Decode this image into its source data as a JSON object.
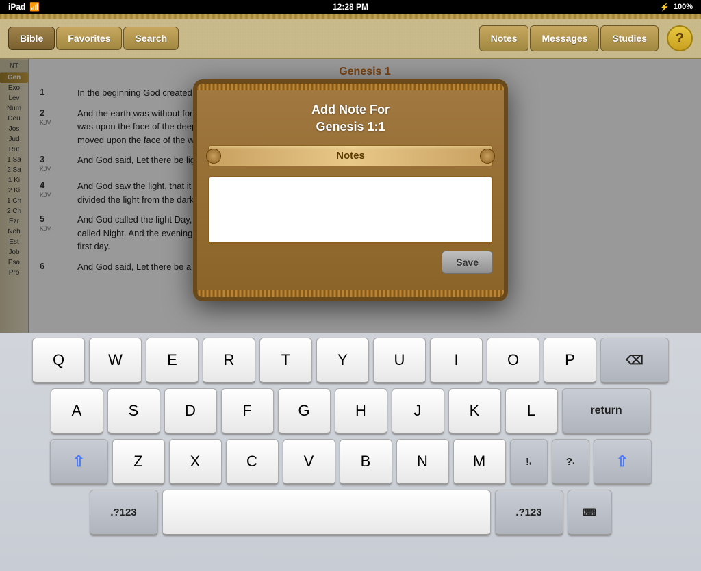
{
  "statusBar": {
    "left": "iPad",
    "time": "12:28 PM",
    "battery": "100%",
    "wifi": "WiFi",
    "bluetooth": "BT"
  },
  "toolbar": {
    "navButtons": [
      {
        "id": "bible",
        "label": "Bible",
        "active": true
      },
      {
        "id": "favorites",
        "label": "Favorites",
        "active": false
      },
      {
        "id": "search",
        "label": "Search",
        "active": false
      }
    ],
    "rightButtons": [
      {
        "id": "notes",
        "label": "Notes"
      },
      {
        "id": "messages",
        "label": "Messages"
      },
      {
        "id": "studies",
        "label": "Studies"
      }
    ],
    "helpLabel": "?"
  },
  "sidebar": {
    "ntLabel": "NT",
    "books": [
      {
        "short": "Gen",
        "active": true
      },
      {
        "short": "Exo",
        "active": false
      },
      {
        "short": "Lev",
        "active": false
      },
      {
        "short": "Num",
        "active": false
      },
      {
        "short": "Deu",
        "active": false
      },
      {
        "short": "Jos",
        "active": false
      },
      {
        "short": "Jud",
        "active": false
      },
      {
        "short": "Rut",
        "active": false
      },
      {
        "short": "1 Sa",
        "active": false
      },
      {
        "short": "2 Sa",
        "active": false
      },
      {
        "short": "1 Ki",
        "active": false
      },
      {
        "short": "2 Ki",
        "active": false
      },
      {
        "short": "1 Ch",
        "active": false
      },
      {
        "short": "2 Ch",
        "active": false
      },
      {
        "short": "Ezr",
        "active": false
      },
      {
        "short": "Neh",
        "active": false
      },
      {
        "short": "Est",
        "active": false
      },
      {
        "short": "Job",
        "active": false
      },
      {
        "short": "Psa",
        "active": false
      },
      {
        "short": "Pro",
        "active": false
      }
    ]
  },
  "bibleText": {
    "chapterTitle": "Genesis 1",
    "verses": [
      {
        "num": "1",
        "translation": "",
        "text": "In the beginning God created the heaven and the..."
      },
      {
        "num": "2",
        "translation": "KJV",
        "text": "And the earth was without form, and void; and da... was upon the face of the deep. And the Spirit of G... moved upon the face of the waters."
      },
      {
        "num": "3",
        "translation": "KJV",
        "text": "And God said, Let there be light: and there was li..."
      },
      {
        "num": "4",
        "translation": "KJV",
        "text": "And God saw the light, that it was good: and Go... divided the light from the darkness."
      },
      {
        "num": "5",
        "translation": "KJV",
        "text": "And God called the light Day, and the darkness h... called Night. And the evening and the morning w... first day."
      },
      {
        "num": "6",
        "translation": "",
        "text": "And God said, Let there be a firmament in the midst of..."
      }
    ]
  },
  "modal": {
    "title": "Add Note For\nGenesis 1:1",
    "titleLine1": "Add Note For",
    "titleLine2": "Genesis 1:1",
    "notesLabel": "Notes",
    "textareaPlaceholder": "",
    "saveLabel": "Save"
  },
  "keyboard": {
    "rows": [
      [
        "Q",
        "W",
        "E",
        "R",
        "T",
        "Y",
        "U",
        "I",
        "O",
        "P"
      ],
      [
        "A",
        "S",
        "D",
        "F",
        "G",
        "H",
        "J",
        "K",
        "L"
      ],
      [
        "Z",
        "X",
        "C",
        "V",
        "B",
        "N",
        "M"
      ]
    ],
    "specialKeys": {
      "backspace": "⌫",
      "return": "return",
      "shiftLeft": "⇧",
      "shiftRight": "⇧",
      "symbolsLeft": ".?123",
      "symbolsRight": ".?123",
      "space": "",
      "keyboard": "⌨"
    }
  }
}
